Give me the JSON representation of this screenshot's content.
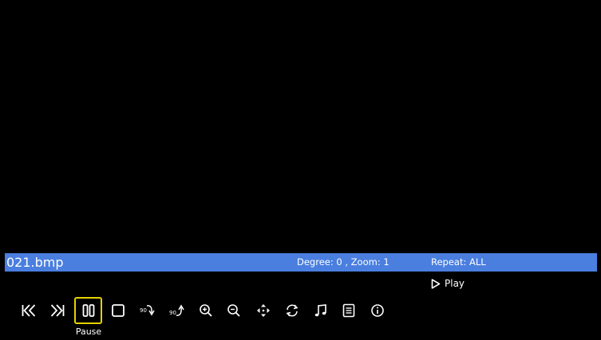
{
  "file": {
    "name": "021.bmp"
  },
  "status": {
    "degree_zoom": "Degree: 0 , Zoom: 1",
    "repeat": "Repeat: ALL",
    "play_label": "Play"
  },
  "controls": [
    {
      "name": "previous",
      "icon": "skip-previous-icon"
    },
    {
      "name": "next",
      "icon": "skip-next-icon"
    },
    {
      "name": "pause",
      "icon": "pause-icon",
      "selected": true,
      "label": "Pause"
    },
    {
      "name": "stop",
      "icon": "stop-icon"
    },
    {
      "name": "rotate-cw",
      "icon": "rotate-90-clockwise-icon"
    },
    {
      "name": "rotate-ccw",
      "icon": "rotate-90-counterclockwise-icon"
    },
    {
      "name": "zoom-in",
      "icon": "zoom-in-icon"
    },
    {
      "name": "zoom-out",
      "icon": "zoom-out-icon"
    },
    {
      "name": "move",
      "icon": "move-view-icon"
    },
    {
      "name": "repeat",
      "icon": "repeat-icon"
    },
    {
      "name": "music",
      "icon": "music-note-icon"
    },
    {
      "name": "playlist",
      "icon": "playlist-icon"
    },
    {
      "name": "info",
      "icon": "info-icon"
    }
  ],
  "theme": {
    "background": "#000000",
    "bar": "#4a7fe0",
    "selection": "#e6d200",
    "text": "#ffffff"
  }
}
